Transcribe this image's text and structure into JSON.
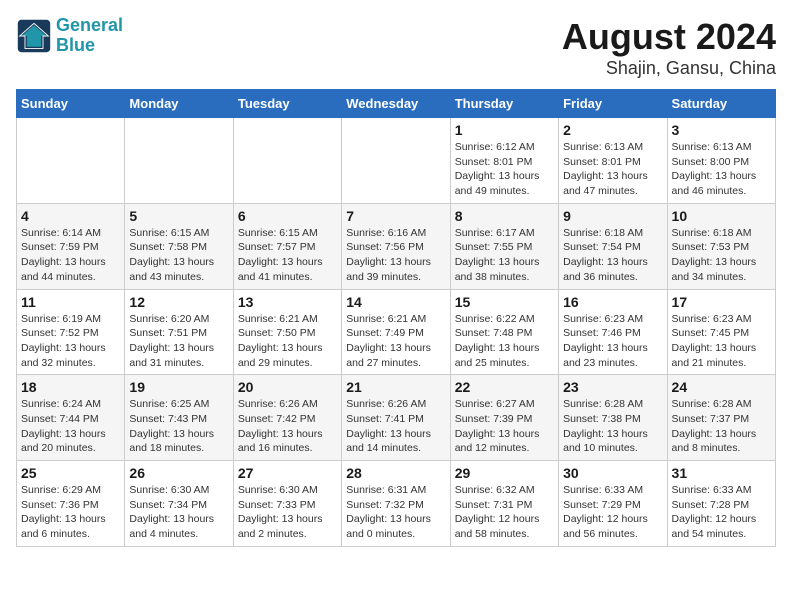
{
  "header": {
    "logo_line1": "General",
    "logo_line2": "Blue",
    "title": "August 2024",
    "subtitle": "Shajin, Gansu, China"
  },
  "days_of_week": [
    "Sunday",
    "Monday",
    "Tuesday",
    "Wednesday",
    "Thursday",
    "Friday",
    "Saturday"
  ],
  "weeks": [
    [
      {
        "day": "",
        "info": ""
      },
      {
        "day": "",
        "info": ""
      },
      {
        "day": "",
        "info": ""
      },
      {
        "day": "",
        "info": ""
      },
      {
        "day": "1",
        "info": "Sunrise: 6:12 AM\nSunset: 8:01 PM\nDaylight: 13 hours\nand 49 minutes."
      },
      {
        "day": "2",
        "info": "Sunrise: 6:13 AM\nSunset: 8:01 PM\nDaylight: 13 hours\nand 47 minutes."
      },
      {
        "day": "3",
        "info": "Sunrise: 6:13 AM\nSunset: 8:00 PM\nDaylight: 13 hours\nand 46 minutes."
      }
    ],
    [
      {
        "day": "4",
        "info": "Sunrise: 6:14 AM\nSunset: 7:59 PM\nDaylight: 13 hours\nand 44 minutes."
      },
      {
        "day": "5",
        "info": "Sunrise: 6:15 AM\nSunset: 7:58 PM\nDaylight: 13 hours\nand 43 minutes."
      },
      {
        "day": "6",
        "info": "Sunrise: 6:15 AM\nSunset: 7:57 PM\nDaylight: 13 hours\nand 41 minutes."
      },
      {
        "day": "7",
        "info": "Sunrise: 6:16 AM\nSunset: 7:56 PM\nDaylight: 13 hours\nand 39 minutes."
      },
      {
        "day": "8",
        "info": "Sunrise: 6:17 AM\nSunset: 7:55 PM\nDaylight: 13 hours\nand 38 minutes."
      },
      {
        "day": "9",
        "info": "Sunrise: 6:18 AM\nSunset: 7:54 PM\nDaylight: 13 hours\nand 36 minutes."
      },
      {
        "day": "10",
        "info": "Sunrise: 6:18 AM\nSunset: 7:53 PM\nDaylight: 13 hours\nand 34 minutes."
      }
    ],
    [
      {
        "day": "11",
        "info": "Sunrise: 6:19 AM\nSunset: 7:52 PM\nDaylight: 13 hours\nand 32 minutes."
      },
      {
        "day": "12",
        "info": "Sunrise: 6:20 AM\nSunset: 7:51 PM\nDaylight: 13 hours\nand 31 minutes."
      },
      {
        "day": "13",
        "info": "Sunrise: 6:21 AM\nSunset: 7:50 PM\nDaylight: 13 hours\nand 29 minutes."
      },
      {
        "day": "14",
        "info": "Sunrise: 6:21 AM\nSunset: 7:49 PM\nDaylight: 13 hours\nand 27 minutes."
      },
      {
        "day": "15",
        "info": "Sunrise: 6:22 AM\nSunset: 7:48 PM\nDaylight: 13 hours\nand 25 minutes."
      },
      {
        "day": "16",
        "info": "Sunrise: 6:23 AM\nSunset: 7:46 PM\nDaylight: 13 hours\nand 23 minutes."
      },
      {
        "day": "17",
        "info": "Sunrise: 6:23 AM\nSunset: 7:45 PM\nDaylight: 13 hours\nand 21 minutes."
      }
    ],
    [
      {
        "day": "18",
        "info": "Sunrise: 6:24 AM\nSunset: 7:44 PM\nDaylight: 13 hours\nand 20 minutes."
      },
      {
        "day": "19",
        "info": "Sunrise: 6:25 AM\nSunset: 7:43 PM\nDaylight: 13 hours\nand 18 minutes."
      },
      {
        "day": "20",
        "info": "Sunrise: 6:26 AM\nSunset: 7:42 PM\nDaylight: 13 hours\nand 16 minutes."
      },
      {
        "day": "21",
        "info": "Sunrise: 6:26 AM\nSunset: 7:41 PM\nDaylight: 13 hours\nand 14 minutes."
      },
      {
        "day": "22",
        "info": "Sunrise: 6:27 AM\nSunset: 7:39 PM\nDaylight: 13 hours\nand 12 minutes."
      },
      {
        "day": "23",
        "info": "Sunrise: 6:28 AM\nSunset: 7:38 PM\nDaylight: 13 hours\nand 10 minutes."
      },
      {
        "day": "24",
        "info": "Sunrise: 6:28 AM\nSunset: 7:37 PM\nDaylight: 13 hours\nand 8 minutes."
      }
    ],
    [
      {
        "day": "25",
        "info": "Sunrise: 6:29 AM\nSunset: 7:36 PM\nDaylight: 13 hours\nand 6 minutes."
      },
      {
        "day": "26",
        "info": "Sunrise: 6:30 AM\nSunset: 7:34 PM\nDaylight: 13 hours\nand 4 minutes."
      },
      {
        "day": "27",
        "info": "Sunrise: 6:30 AM\nSunset: 7:33 PM\nDaylight: 13 hours\nand 2 minutes."
      },
      {
        "day": "28",
        "info": "Sunrise: 6:31 AM\nSunset: 7:32 PM\nDaylight: 13 hours\nand 0 minutes."
      },
      {
        "day": "29",
        "info": "Sunrise: 6:32 AM\nSunset: 7:31 PM\nDaylight: 12 hours\nand 58 minutes."
      },
      {
        "day": "30",
        "info": "Sunrise: 6:33 AM\nSunset: 7:29 PM\nDaylight: 12 hours\nand 56 minutes."
      },
      {
        "day": "31",
        "info": "Sunrise: 6:33 AM\nSunset: 7:28 PM\nDaylight: 12 hours\nand 54 minutes."
      }
    ]
  ]
}
